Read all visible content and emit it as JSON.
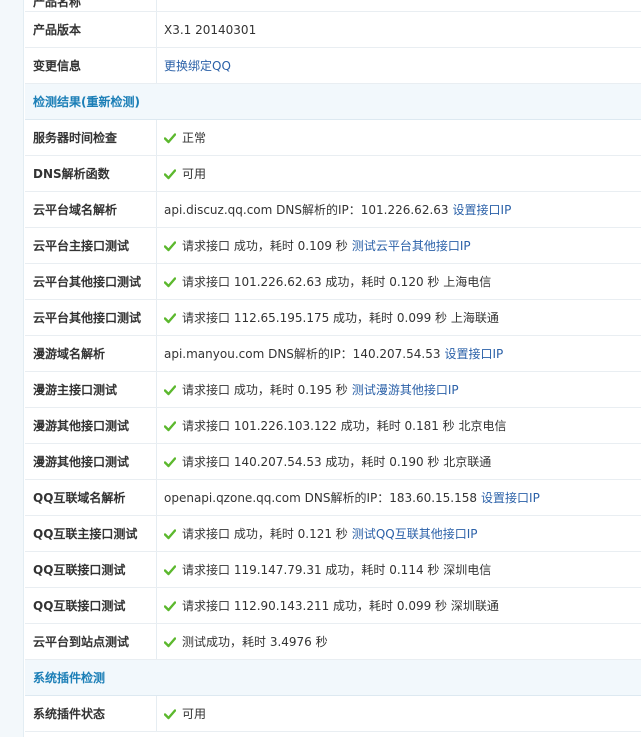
{
  "top_cutoff": {
    "label": "产品名称",
    "value": ""
  },
  "product_info": [
    {
      "label": "产品版本",
      "value": "X3.1 20140301",
      "link": ""
    },
    {
      "label": "变更信息",
      "value": "",
      "link": "更换绑定QQ"
    }
  ],
  "section_check": {
    "title": "检测结果",
    "link": "(重新检测)"
  },
  "checks": [
    {
      "label": "服务器时间检查",
      "ok": true,
      "text": "正常",
      "link": ""
    },
    {
      "label": "DNS解析函数",
      "ok": true,
      "text": "可用",
      "link": ""
    },
    {
      "label": "云平台域名解析",
      "ok": false,
      "text": "api.discuz.qq.com DNS解析的IP：101.226.62.63",
      "link": "设置接口IP"
    },
    {
      "label": "云平台主接口测试",
      "ok": true,
      "text": "请求接口 成功，耗时 0.109 秒",
      "link": "测试云平台其他接口IP"
    },
    {
      "label": "云平台其他接口测试",
      "ok": true,
      "text": "请求接口 101.226.62.63 成功，耗时 0.120 秒 上海电信",
      "link": ""
    },
    {
      "label": "云平台其他接口测试",
      "ok": true,
      "text": "请求接口 112.65.195.175 成功，耗时 0.099 秒 上海联通",
      "link": ""
    },
    {
      "label": "漫游域名解析",
      "ok": false,
      "text": "api.manyou.com DNS解析的IP：140.207.54.53",
      "link": "设置接口IP"
    },
    {
      "label": "漫游主接口测试",
      "ok": true,
      "text": "请求接口 成功，耗时 0.195 秒",
      "link": "测试漫游其他接口IP"
    },
    {
      "label": "漫游其他接口测试",
      "ok": true,
      "text": "请求接口 101.226.103.122 成功，耗时 0.181 秒 北京电信",
      "link": ""
    },
    {
      "label": "漫游其他接口测试",
      "ok": true,
      "text": "请求接口 140.207.54.53 成功，耗时 0.190 秒 北京联通",
      "link": ""
    },
    {
      "label": "QQ互联域名解析",
      "ok": false,
      "text": "openapi.qzone.qq.com DNS解析的IP：183.60.15.158",
      "link": "设置接口IP"
    },
    {
      "label": "QQ互联主接口测试",
      "ok": true,
      "text": "请求接口 成功，耗时 0.121 秒",
      "link": "测试QQ互联其他接口IP"
    },
    {
      "label": "QQ互联接口测试",
      "ok": true,
      "text": "请求接口 119.147.79.31 成功，耗时 0.114 秒 深圳电信",
      "link": ""
    },
    {
      "label": "QQ互联接口测试",
      "ok": true,
      "text": "请求接口 112.90.143.211 成功，耗时 0.099 秒 深圳联通",
      "link": ""
    },
    {
      "label": "云平台到站点测试",
      "ok": true,
      "text": "测试成功，耗时 3.4976 秒",
      "link": ""
    }
  ],
  "section_plugin": {
    "title": "系统插件检测"
  },
  "plugin_rows": [
    {
      "label": "系统插件状态",
      "ok": true,
      "text": "可用",
      "link": ""
    }
  ],
  "colors": {
    "link": "#2b61a8",
    "section_title": "#1c7fb7",
    "check": "#5cb82e"
  }
}
